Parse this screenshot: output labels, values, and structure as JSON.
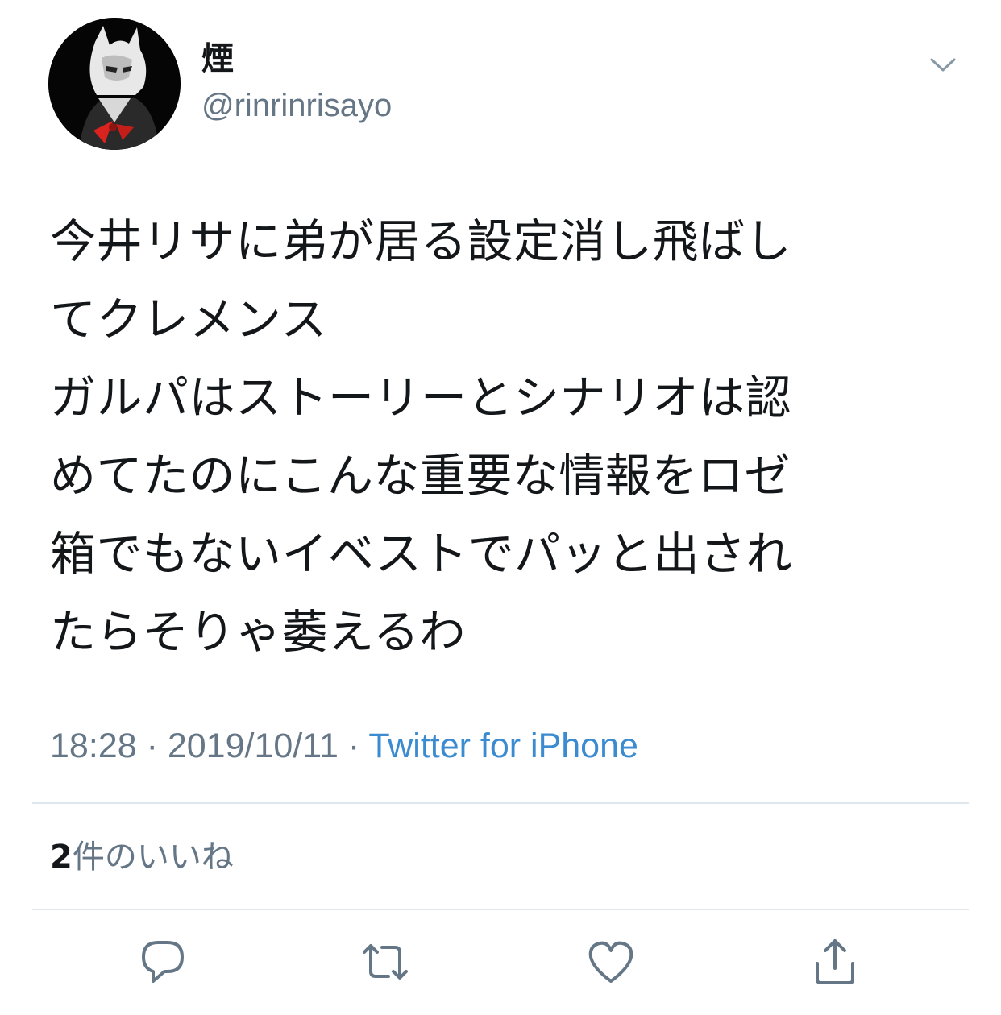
{
  "author": {
    "display_name": "煙",
    "handle": "@rinrinrisayo"
  },
  "tweet": {
    "lines": [
      "今井リサに弟が居る設定消し飛ばし",
      "てクレメンス",
      "ガルパはストーリーとシナリオは認",
      "めてたのにこんな重要な情報をロゼ",
      "箱でもないイベストでパッと出され",
      "たらそりゃ萎えるわ"
    ],
    "time": "18:28",
    "date": "2019/10/11",
    "separator": "·",
    "source": "Twitter for iPhone"
  },
  "engagement": {
    "likes_count": "2",
    "likes_label": "件のいいね"
  },
  "actions": [
    {
      "icon": "reply-icon"
    },
    {
      "icon": "retweet-icon"
    },
    {
      "icon": "like-icon"
    },
    {
      "icon": "share-icon"
    }
  ],
  "colors": {
    "text": "#14171a",
    "secondary": "#657786",
    "link": "#3b8bd0",
    "divider": "#e1e8ed"
  }
}
